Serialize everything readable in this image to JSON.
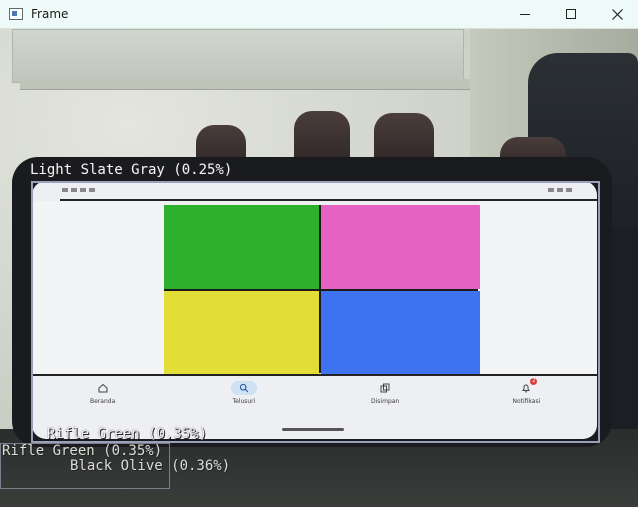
{
  "window": {
    "title": "Frame",
    "minimize_symbol": "—",
    "maximize_symbol": "□",
    "close_symbol": "✕"
  },
  "phone": {
    "nav_items": [
      {
        "label": "Beranda",
        "icon": "home-icon"
      },
      {
        "label": "Telusuri",
        "icon": "search-icon",
        "active": true
      },
      {
        "label": "Disimpan",
        "icon": "copy-icon"
      },
      {
        "label": "Notifikasi",
        "icon": "bell-icon",
        "badge": "2"
      }
    ],
    "tile_colors": [
      "#2cb02e",
      "#e463c2",
      "#e3dd38",
      "#3f72ee"
    ]
  },
  "detections": [
    {
      "label": "Light Slate Gray (0.25%)"
    },
    {
      "label": "Rifle Green (0.35%)"
    },
    {
      "label": "Rifle Green (0.35%)"
    },
    {
      "label": "Black Olive (0.36%)"
    }
  ],
  "colors": {
    "titlebar": "#eefaf8",
    "box_stroke": "#9aa0b8",
    "label_text": "#f3f3f3"
  }
}
